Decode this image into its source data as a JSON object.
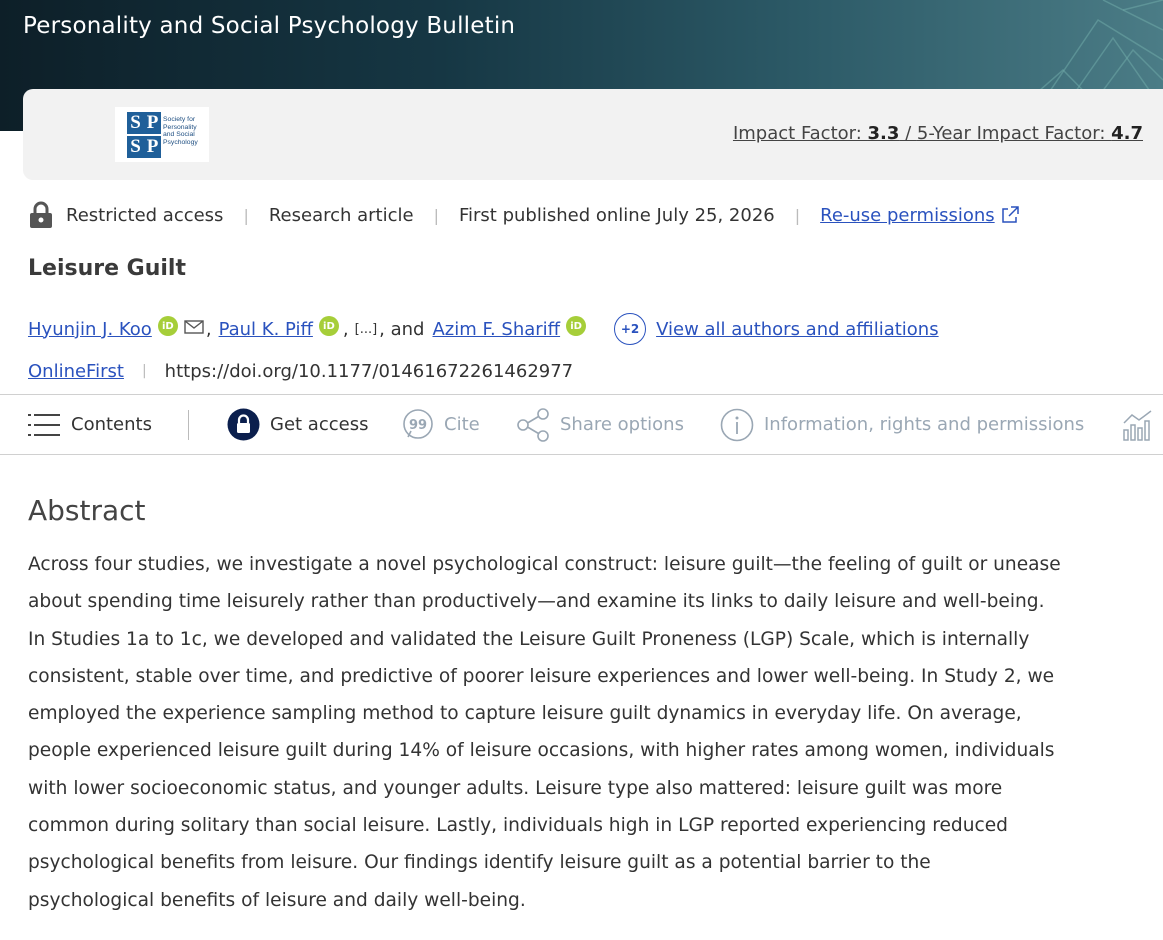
{
  "journal": {
    "title": "Personality and Social Psychology Bulletin"
  },
  "header": {
    "logo_letters": [
      "S",
      "P",
      "S",
      "P"
    ],
    "logo_text": "Society for Personality and Social Psychology",
    "impact_label": "Impact Factor: ",
    "impact_value": "3.3",
    "impact_sep": " / ",
    "five_year_label": "5-Year Impact Factor: ",
    "five_year_value": "4.7"
  },
  "meta": {
    "access": "Restricted access",
    "sep": "|",
    "type": "Research article",
    "published": "First published online July 25, 2026",
    "permissions": "Re-use permissions"
  },
  "article": {
    "title": "Leisure Guilt"
  },
  "authors": {
    "author1": "Hyunjin J. Koo",
    "comma": ",",
    "author2": "Paul K. Piff",
    "ellipsis": "[...]",
    "and_text": ", and",
    "author3": "Azim F. Shariff",
    "orcid_label": "iD",
    "more_badge": "+2",
    "view_all": "View all authors and affiliations"
  },
  "doi": {
    "stage": "OnlineFirst",
    "sep": "|",
    "url": "https://doi.org/10.1177/01461672261462977"
  },
  "toolbar": {
    "contents": "Contents",
    "get_access": "Get access",
    "cite": "Cite",
    "share": "Share options",
    "info": "Information, rights and permissions"
  },
  "abstract": {
    "heading": "Abstract",
    "lines": [
      "Across four studies, we investigate a novel psychological construct: leisure guilt—the feeling of guilt or unease",
      "about spending time leisurely rather than productively—and examine its links to daily leisure and well-being.",
      "In Studies 1a to 1c, we developed and validated the Leisure Guilt Proneness (LGP) Scale, which is internally",
      "consistent, stable over time, and predictive of poorer leisure experiences and lower well-being. In Study 2, we",
      "employed the experience sampling method to capture leisure guilt dynamics in everyday life. On average,",
      "people experienced leisure guilt during 14% of leisure occasions, with higher rates among women, individuals",
      "with lower socioeconomic status, and younger adults. Leisure type also mattered: leisure guilt was more",
      "common during solitary than social leisure. Lastly, individuals high in LGP reported experiencing reduced",
      "psychological benefits from leisure. Our findings identify leisure guilt as a potential barrier to the",
      "psychological benefits of leisure and daily well-being."
    ]
  },
  "colors": {
    "link": "#2a52be",
    "orcid": "#a6ce39",
    "banner_dark": "#0d1f28",
    "banner_light": "#4b7c86",
    "muted_toolbar": "#9aa7b4"
  }
}
